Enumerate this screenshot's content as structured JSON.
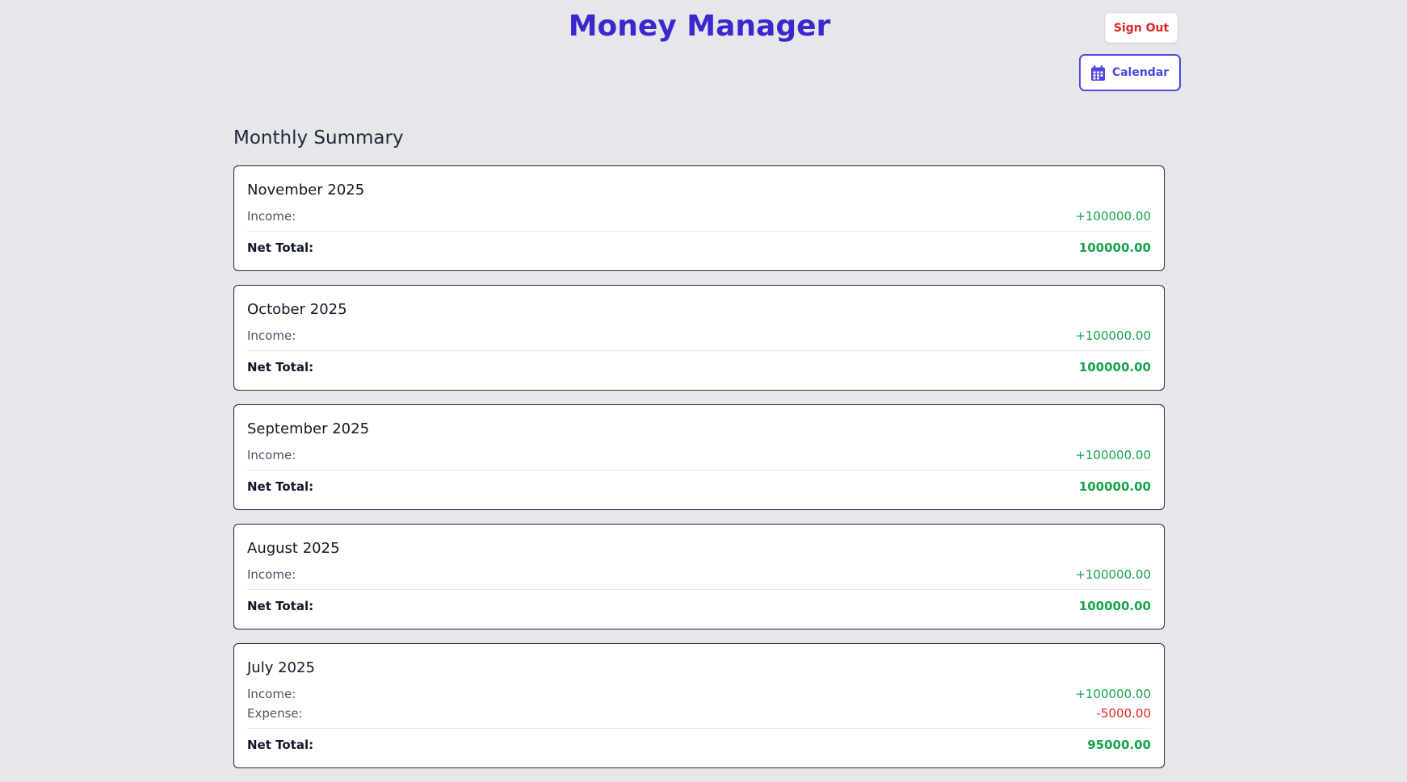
{
  "header": {
    "title": "Money Manager",
    "sign_out_label": "Sign Out",
    "calendar_label": "Calendar",
    "calendar_icon": "calendar-icon"
  },
  "colors": {
    "brand": "#3b28cc",
    "accent": "#4f46e5",
    "income": "#16a34a",
    "expense": "#dc2626",
    "background": "#e5e7eb"
  },
  "summary": {
    "title": "Monthly Summary",
    "months": [
      {
        "name": "November 2025",
        "income_label": "Income:",
        "income": "+100000.00",
        "net_label": "Net Total:",
        "net": "100000.00"
      },
      {
        "name": "October 2025",
        "income_label": "Income:",
        "income": "+100000.00",
        "net_label": "Net Total:",
        "net": "100000.00"
      },
      {
        "name": "September 2025",
        "income_label": "Income:",
        "income": "+100000.00",
        "net_label": "Net Total:",
        "net": "100000.00"
      },
      {
        "name": "August 2025",
        "income_label": "Income:",
        "income": "+100000.00",
        "net_label": "Net Total:",
        "net": "100000.00"
      },
      {
        "name": "July 2025",
        "income_label": "Income:",
        "income": "+100000.00",
        "expense_label": "Expense:",
        "expense": "-5000.00",
        "net_label": "Net Total:",
        "net": "95000.00"
      }
    ]
  }
}
